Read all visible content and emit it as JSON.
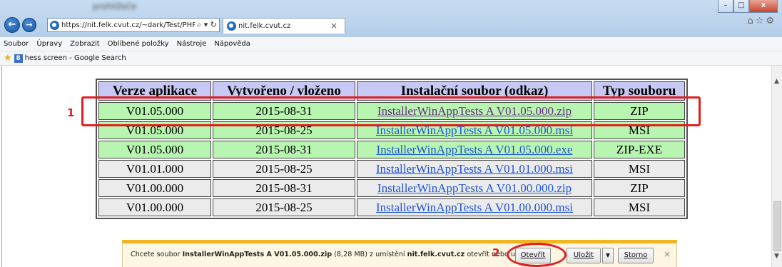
{
  "browser": {
    "title": "prohlížeče",
    "url": "https://nit.felk.cvut.cz/~dark/Test/PHPT",
    "address_controls": "⌕ ▾ ↻",
    "tab_title": "nit.felk.cvut.cz",
    "tab_close": "×",
    "window_buttons": {
      "minimize": "–",
      "maximize": "□",
      "close": "x"
    },
    "toolbar_icons": "⌂☆⚙"
  },
  "menu": [
    "Soubor",
    "Úpravy",
    "Zobrazit",
    "Oblíbené položky",
    "Nástroje",
    "Nápověda"
  ],
  "favorites": {
    "item": "hess screen - Google Search"
  },
  "table": {
    "headers": [
      "Verze aplikace",
      "Vytvořeno / vloženo",
      "Instalační soubor (odkaz)",
      "Typ souboru"
    ],
    "rows": [
      {
        "version": "V01.05.000",
        "date": "2015-08-31",
        "file": "InstallerWinAppTests A V01.05.000.zip",
        "type": "ZIP",
        "style": "green",
        "visited": true
      },
      {
        "version": "V01.05.000",
        "date": "2015-08-25",
        "file": "InstallerWinAppTests A V01.05.000.msi",
        "type": "MSI",
        "style": "green",
        "visited": false
      },
      {
        "version": "V01.05.000",
        "date": "2015-08-31",
        "file": "InstallerWinAppTests A V01.05.000.exe",
        "type": "ZIP-EXE",
        "style": "green",
        "visited": false
      },
      {
        "version": "V01.01.000",
        "date": "2015-08-25",
        "file": "InstallerWinAppTests A V01.01.000.msi",
        "type": "MSI",
        "style": "gray",
        "visited": false
      },
      {
        "version": "V01.00.000",
        "date": "2015-08-31",
        "file": "InstallerWinAppTests A V01.00.000.zip",
        "type": "ZIP",
        "style": "gray",
        "visited": false
      },
      {
        "version": "V01.00.000",
        "date": "2015-08-25",
        "file": "InstallerWinAppTests A V01.00.000.msi",
        "type": "MSI",
        "style": "gray",
        "visited": false
      }
    ]
  },
  "annotations": {
    "step1": "1",
    "step2": "2",
    "color": "#e02020"
  },
  "download_bar": {
    "prefix": "Chcete soubor ",
    "filename": "InstallerWinAppTests A V01.05.000.zip",
    "size": " (8,28 MB) z umístění ",
    "host": "nit.felk.cvut.cz",
    "suffix": " otevřít nebo uložit?",
    "open_label": "Otevřít",
    "save_label": "Uložit",
    "save_dropdown": "▼",
    "cancel_label": "Storno",
    "close": "×"
  },
  "colors": {
    "header_bg": "#c8c8f4",
    "green_row": "#b8f5b0",
    "gray_row": "#ebebeb",
    "link": "#1f55d6",
    "visited_link": "#6b2a8a",
    "notification_accent": "#f2b51f"
  }
}
